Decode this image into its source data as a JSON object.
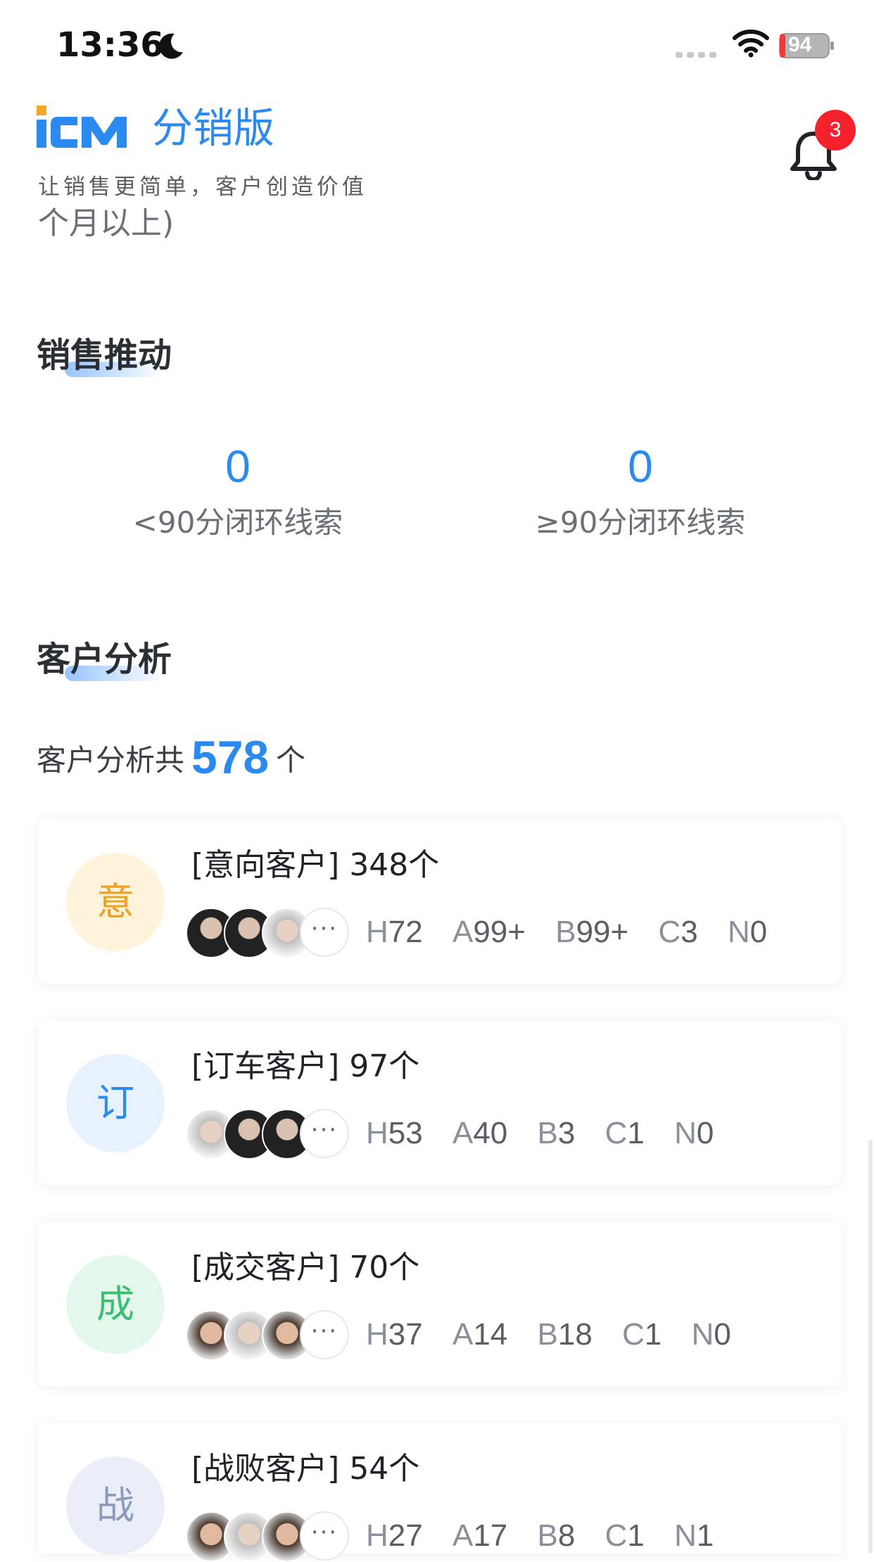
{
  "status_bar": {
    "time": "13:36",
    "battery": "94"
  },
  "header": {
    "app_subtitle": "分销版",
    "slogan": "让销售更简单，客户创造价值",
    "clipped_text": "个月以上)",
    "notification_count": "3"
  },
  "sales_push": {
    "title": "销售推动",
    "stats": [
      {
        "value": "0",
        "label": "<90分闭环线索"
      },
      {
        "value": "0",
        "label": "≥90分闭环线索"
      }
    ]
  },
  "customer_analysis": {
    "title": "客户分析",
    "summary_prefix": "客户分析共",
    "total": "578",
    "summary_suffix": "个",
    "cards": [
      {
        "icon_char": "意",
        "title": "[意向客户] 348个",
        "grades": [
          {
            "k": "H",
            "v": "72"
          },
          {
            "k": "A",
            "v": "99+"
          },
          {
            "k": "B",
            "v": "99+"
          },
          {
            "k": "C",
            "v": "3"
          },
          {
            "k": "N",
            "v": "0"
          }
        ]
      },
      {
        "icon_char": "订",
        "title": "[订车客户] 97个",
        "grades": [
          {
            "k": "H",
            "v": "53"
          },
          {
            "k": "A",
            "v": "40"
          },
          {
            "k": "B",
            "v": "3"
          },
          {
            "k": "C",
            "v": "1"
          },
          {
            "k": "N",
            "v": "0"
          }
        ]
      },
      {
        "icon_char": "成",
        "title": "[成交客户] 70个",
        "grades": [
          {
            "k": "H",
            "v": "37"
          },
          {
            "k": "A",
            "v": "14"
          },
          {
            "k": "B",
            "v": "18"
          },
          {
            "k": "C",
            "v": "1"
          },
          {
            "k": "N",
            "v": "0"
          }
        ]
      },
      {
        "icon_char": "战",
        "title": "[战败客户] 54个",
        "grades": [
          {
            "k": "H",
            "v": "27"
          },
          {
            "k": "A",
            "v": "17"
          },
          {
            "k": "B",
            "v": "8"
          },
          {
            "k": "C",
            "v": "1"
          },
          {
            "k": "N",
            "v": "1"
          }
        ]
      }
    ],
    "more_label": "···"
  },
  "colors": {
    "accent": "#2b8af0",
    "yixiang_bg": "#fff3dc",
    "yixiang_fg": "#f0a020",
    "dingche_bg": "#e8f1ff",
    "dingche_fg": "#2b8af0",
    "chengjiao_bg": "#e3f7ea",
    "chengjiao_fg": "#3cbf73",
    "zhanbai_bg": "#e9eef8",
    "zhanbai_fg": "#8b9bb8",
    "badge": "#f5222d"
  }
}
